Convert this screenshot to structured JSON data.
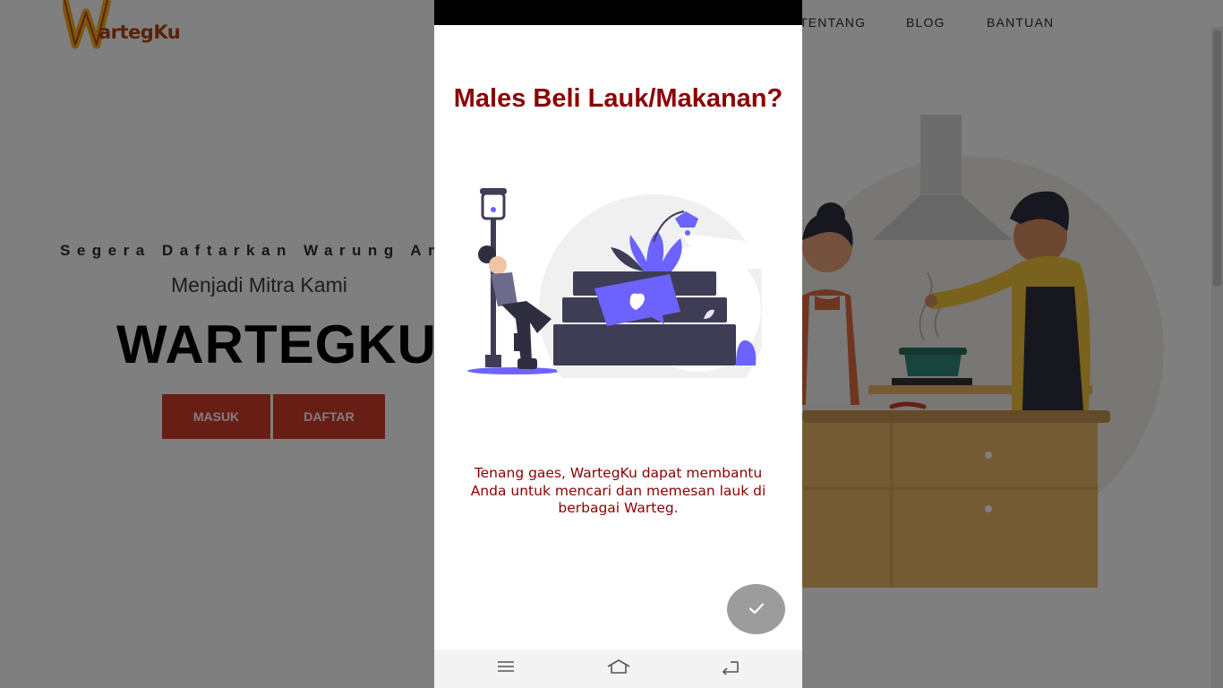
{
  "site": {
    "logo_text": "artegKu",
    "nav": [
      "TENTANG",
      "BLOG",
      "BANTUAN"
    ],
    "hero": {
      "tagline": "Segera Daftarkan Warung Anda",
      "subtitle": "Menjadi Mitra Kami",
      "title": "WARTEGKU",
      "login_label": "MASUK",
      "register_label": "DAFTAR"
    }
  },
  "app_intro": {
    "title": "Males Beli Lauk/Makanan?",
    "description": "Tenang gaes, WartegKu dapat membantu Anda untuk mencari dan memesan lauk di berbagai Warteg.",
    "done_icon": "check-icon"
  },
  "system_nav": {
    "menu_icon": "menu-icon",
    "home_icon": "home-icon",
    "back_icon": "back-icon"
  },
  "colors": {
    "title_red": "#8b0000",
    "button_red": "#d13a2a",
    "illustration_accent": "#6c63ff",
    "illustration_dark": "#3f3d56"
  }
}
